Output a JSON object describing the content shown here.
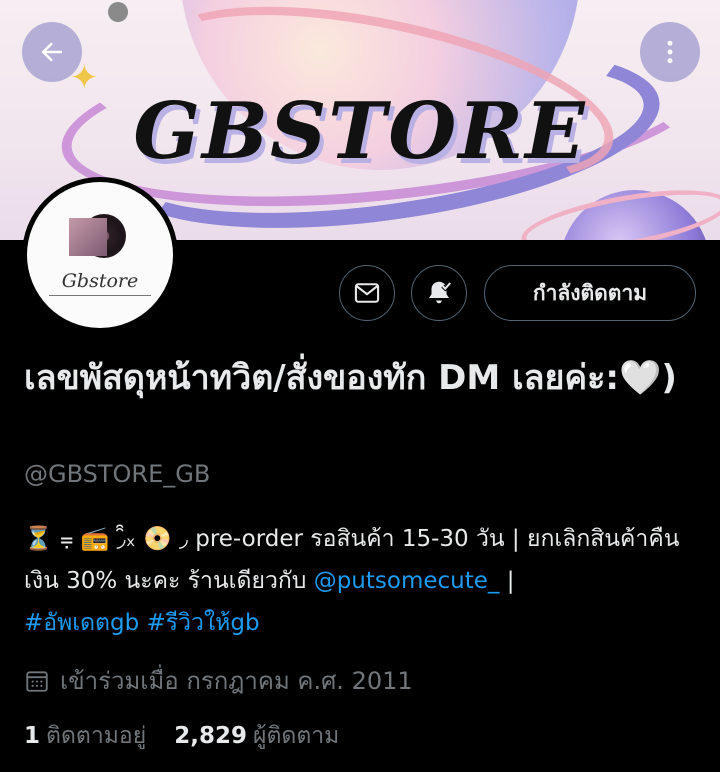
{
  "banner": {
    "brand_text": "GBSTORE",
    "colors": {
      "planet": "#b9b4ea",
      "ring": "#8f86d8",
      "accent_pink": "#f0a4b4",
      "background": "#f4e9ef"
    }
  },
  "nav": {
    "back_icon": "arrow-left-icon",
    "more_icon": "more-vertical-icon"
  },
  "avatar": {
    "logo_text": "Gbstore"
  },
  "actions": {
    "message_icon": "mail-icon",
    "notify_icon": "bell-check-icon",
    "follow_label": "กำลังติดตาม"
  },
  "profile": {
    "name": "เลขพัสดุหน้าทวิต/สั่งของทัก DM เลยค่ะ:🤍)",
    "handle": "@GBSTORE_GB",
    "bio_prefix": "⏳ ⩦ 📻 ◞̑̑ₓ 📀 ◞ pre-order รอสินค้า 15-30 วัน | ยกเลิกสินค้าคืนเงิน 30% นะคะ ร้านเดียวกับ ",
    "bio_mention": "@putsomecute_",
    "bio_sep": " | ",
    "bio_tag1": "#อัพเดตgb",
    "bio_tag2": "#รีวิวให้gb",
    "joined_icon": "calendar-icon",
    "joined": "เข้าร่วมเมื่อ กรกฎาคม ค.ศ. 2011",
    "following_count": "1",
    "following_label": "ติดตามอยู่",
    "followers_count": "2,829",
    "followers_label": "ผู้ติดตาม"
  },
  "theme": {
    "link": "#1d9bf0",
    "muted": "#71767b",
    "text": "#e7e9ea",
    "border": "#536471"
  }
}
